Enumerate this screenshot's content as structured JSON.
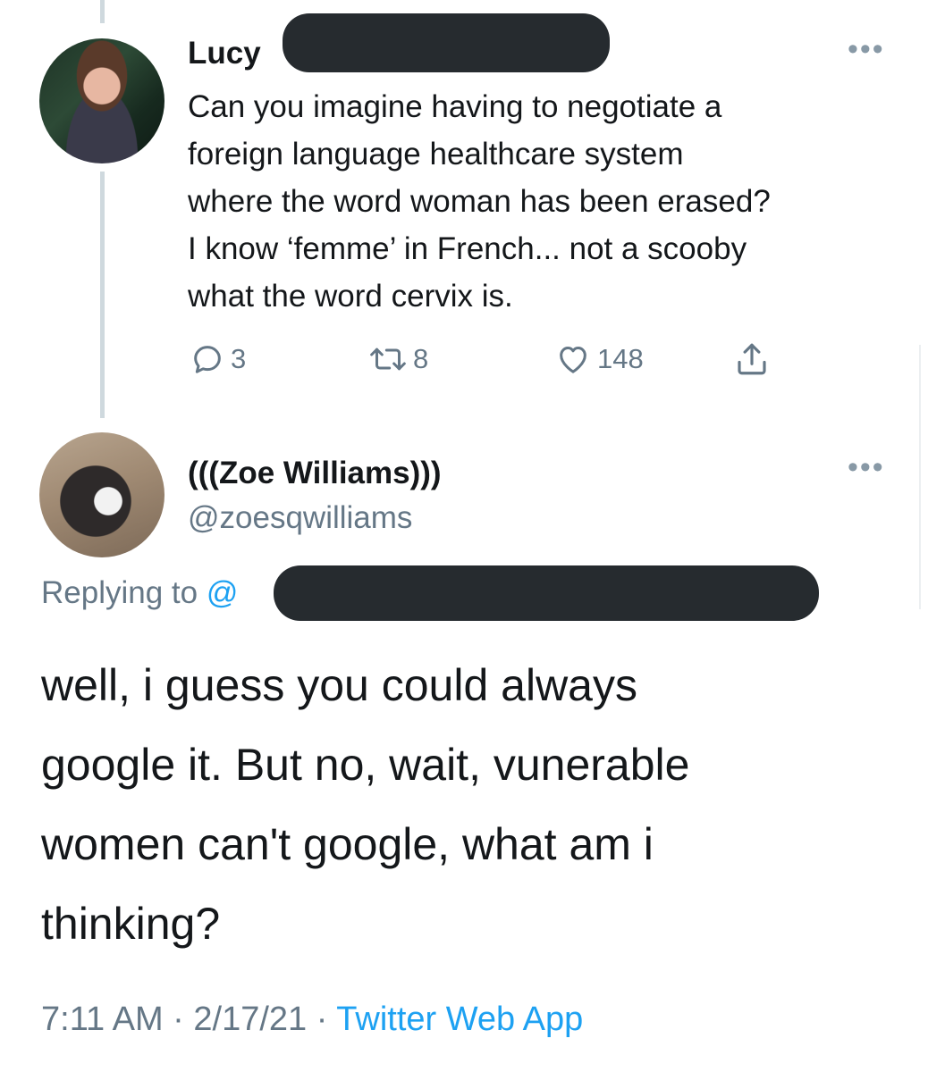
{
  "parent_tweet": {
    "author_name": "Lucy",
    "text": "Can you imagine having to negotiate a\nforeign language healthcare system\nwhere the word woman has been erased?\nI know ‘femme’ in French... not a scooby\nwhat the word cervix is.",
    "replies": "3",
    "retweets": "8",
    "likes": "148",
    "more_icon": "more-horizontal-icon"
  },
  "reply_tweet": {
    "author_name": "(((Zoe Williams)))",
    "handle": "@zoesqwilliams",
    "replying_to_label": "Replying to",
    "replying_to_mention": "@",
    "text": "well, i guess you could always\ngoogle it. But no, wait, vunerable\nwomen can't google, what am i\nthinking?",
    "time": "7:11 AM",
    "date": "2/17/21",
    "separator": "·",
    "source": "Twitter Web App",
    "more_icon": "more-horizontal-icon"
  },
  "colors": {
    "text": "#14171a",
    "secondary": "#657786",
    "link": "#1da1f2",
    "thread_line": "#cfd9de",
    "redaction": "#262b2f"
  }
}
